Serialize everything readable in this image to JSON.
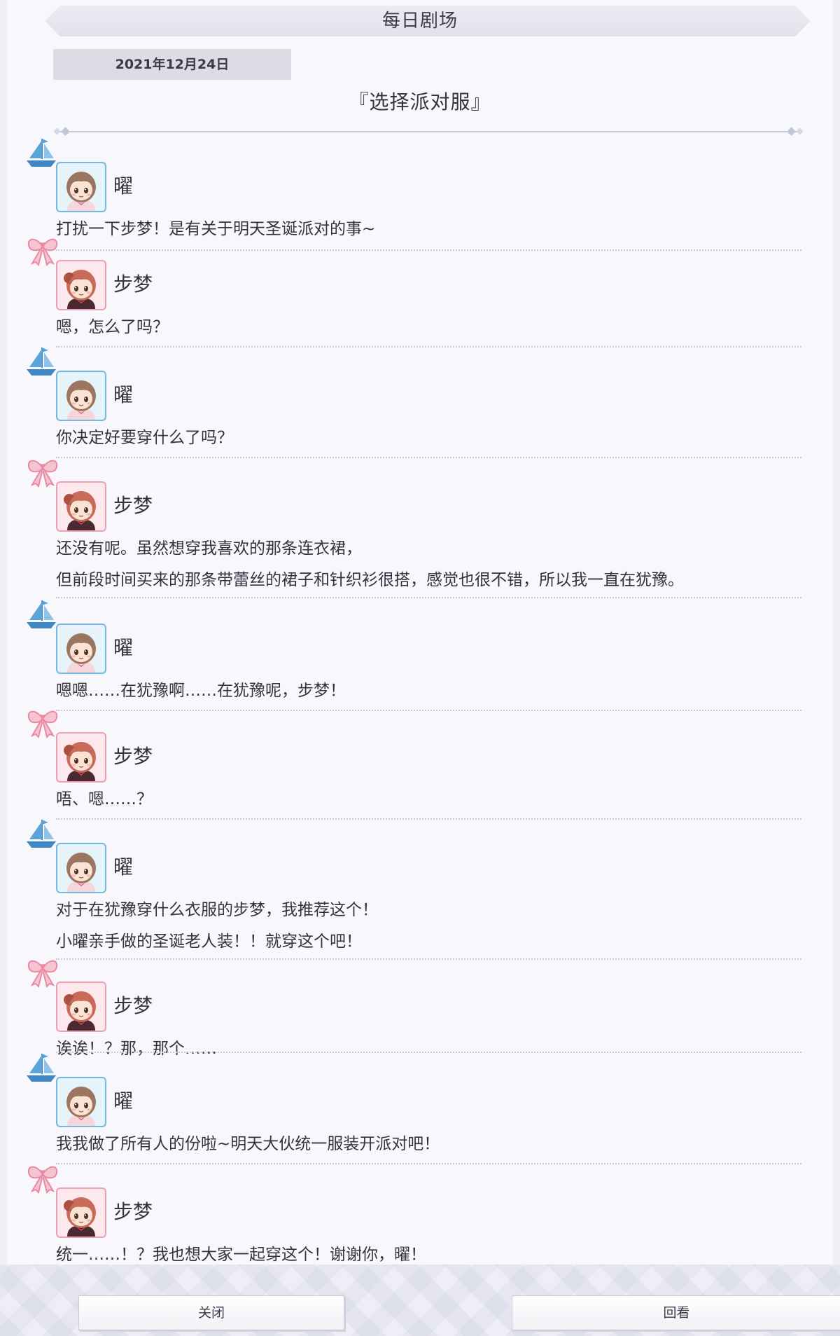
{
  "header": {
    "title": "每日剧场"
  },
  "date": "2021年12月24日",
  "story_title": "『选择派对服』",
  "messages": [
    {
      "speaker": "曜",
      "character": "you",
      "deco_icon": "sailboat-icon",
      "lines": [
        "打扰一下步梦！是有关于明天圣诞派对的事~"
      ]
    },
    {
      "speaker": "步梦",
      "character": "ayumu",
      "deco_icon": "ribbon-bow-icon",
      "lines": [
        "嗯，怎么了吗？"
      ]
    },
    {
      "speaker": "曜",
      "character": "you",
      "deco_icon": "sailboat-icon",
      "lines": [
        "你决定好要穿什么了吗？"
      ]
    },
    {
      "speaker": "步梦",
      "character": "ayumu",
      "deco_icon": "ribbon-bow-icon",
      "lines": [
        "还没有呢。虽然想穿我喜欢的那条连衣裙，",
        "但前段时间买来的那条带蕾丝的裙子和针织衫很搭，感觉也很不错，所以我一直在犹豫。"
      ]
    },
    {
      "speaker": "曜",
      "character": "you",
      "deco_icon": "sailboat-icon",
      "lines": [
        "嗯嗯……在犹豫啊……在犹豫呢，步梦！"
      ]
    },
    {
      "speaker": "步梦",
      "character": "ayumu",
      "deco_icon": "ribbon-bow-icon",
      "lines": [
        "唔、嗯……？"
      ]
    },
    {
      "speaker": "曜",
      "character": "you",
      "deco_icon": "sailboat-icon",
      "lines": [
        "对于在犹豫穿什么衣服的步梦，我推荐这个！",
        "小曜亲手做的圣诞老人装！！就穿这个吧！"
      ]
    },
    {
      "speaker": "步梦",
      "character": "ayumu",
      "deco_icon": "ribbon-bow-icon",
      "lines": [
        "诶诶！？那，那个……"
      ]
    },
    {
      "speaker": "曜",
      "character": "you",
      "deco_icon": "sailboat-icon",
      "lines": [
        "我我做了所有人的份啦~明天大伙统一服装开派对吧！"
      ]
    },
    {
      "speaker": "步梦",
      "character": "ayumu",
      "deco_icon": "ribbon-bow-icon",
      "lines": [
        "统一……！？我也想大家一起穿这个！谢谢你，曜！"
      ]
    }
  ],
  "buttons": {
    "close": "关闭",
    "review": "回看"
  },
  "colors": {
    "you_accent": "#78b8e0",
    "ayumu_accent": "#ec9fb5",
    "sailboat": "#4f9cd4",
    "bow": "#ef8ea6"
  }
}
